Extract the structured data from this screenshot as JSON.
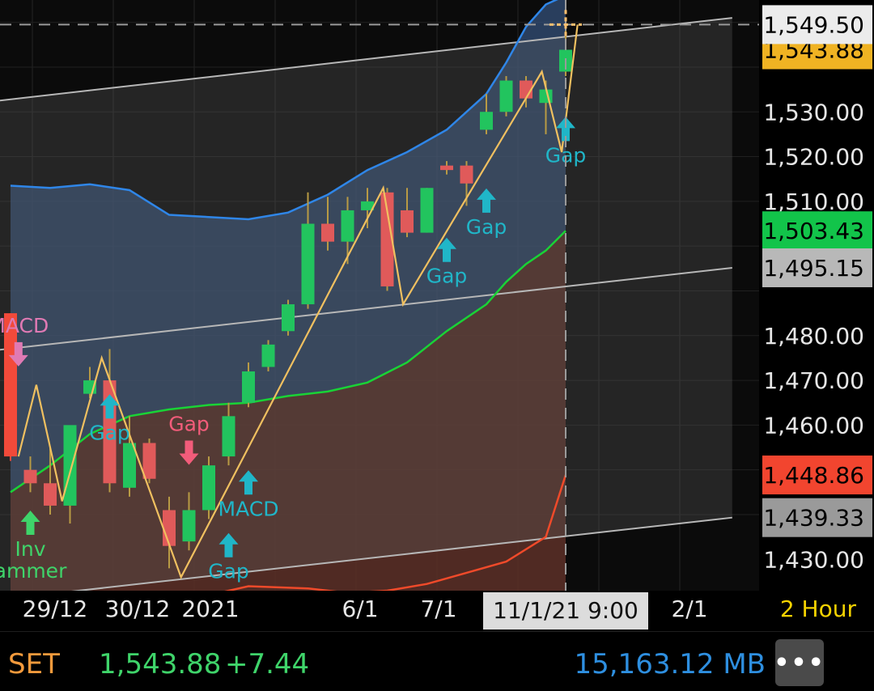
{
  "chart_data": {
    "type": "candlestick",
    "timeframe": "2 Hour",
    "x_tick_labels": [
      "29/12",
      "30/12",
      "2021",
      "6/1",
      "7/1",
      "2/1"
    ],
    "crosshair": {
      "x_label": "11/1/21 9:00",
      "y_label": "1,549.50",
      "y_value": 1549.5
    },
    "y_range": [
      1423,
      1555
    ],
    "y_tick_labels": [
      "1,530.00",
      "1,520.00",
      "1,510.00",
      "1,480.00",
      "1,470.00",
      "1,460.00",
      "1,430.00"
    ],
    "price_badges": [
      {
        "label": "1,543.88",
        "value": 1543.88,
        "bg": "#f0b323",
        "fg": "#000000"
      },
      {
        "label": "1,503.43",
        "value": 1503.43,
        "bg": "#12c44a",
        "fg": "#000000"
      },
      {
        "label": "1,495.15",
        "value": 1495.15,
        "bg": "#b8b8b8",
        "fg": "#000000"
      },
      {
        "label": "1,448.86",
        "value": 1448.86,
        "bg": "#f2452f",
        "fg": "#000000"
      },
      {
        "label": "1,439.33",
        "value": 1439.33,
        "bg": "#9a9a9a",
        "fg": "#000000"
      }
    ],
    "candles": [
      {
        "i": 0,
        "o": 1485.0,
        "h": 1485.0,
        "l": 1452.0,
        "c": 1453.0
      },
      {
        "i": 1,
        "o": 1450.0,
        "h": 1453.0,
        "l": 1445.0,
        "c": 1447.0
      },
      {
        "i": 2,
        "o": 1447.0,
        "h": 1455.0,
        "l": 1440.0,
        "c": 1442.0
      },
      {
        "i": 3,
        "o": 1442.0,
        "h": 1448.0,
        "l": 1438.0,
        "c": 1460.0
      },
      {
        "i": 4,
        "o": 1467.0,
        "h": 1473.0,
        "l": 1466.0,
        "c": 1470.0
      },
      {
        "i": 5,
        "o": 1470.0,
        "h": 1477.0,
        "l": 1445.0,
        "c": 1447.0
      },
      {
        "i": 6,
        "o": 1446.0,
        "h": 1462.0,
        "l": 1444.0,
        "c": 1456.0
      },
      {
        "i": 7,
        "o": 1456.0,
        "h": 1457.0,
        "l": 1447.0,
        "c": 1448.0
      },
      {
        "i": 8,
        "o": 1441.0,
        "h": 1444.0,
        "l": 1428.0,
        "c": 1433.0
      },
      {
        "i": 9,
        "o": 1434.0,
        "h": 1445.0,
        "l": 1432.0,
        "c": 1441.0
      },
      {
        "i": 10,
        "o": 1441.0,
        "h": 1453.0,
        "l": 1439.0,
        "c": 1451.0
      },
      {
        "i": 11,
        "o": 1453.0,
        "h": 1465.0,
        "l": 1451.0,
        "c": 1462.0
      },
      {
        "i": 12,
        "o": 1465.0,
        "h": 1474.0,
        "l": 1464.0,
        "c": 1472.0
      },
      {
        "i": 13,
        "o": 1473.0,
        "h": 1479.0,
        "l": 1472.0,
        "c": 1478.0
      },
      {
        "i": 14,
        "o": 1481.0,
        "h": 1488.0,
        "l": 1480.0,
        "c": 1487.0
      },
      {
        "i": 15,
        "o": 1487.0,
        "h": 1512.0,
        "l": 1486.0,
        "c": 1505.0
      },
      {
        "i": 16,
        "o": 1505.0,
        "h": 1511.0,
        "l": 1499.0,
        "c": 1501.0
      },
      {
        "i": 17,
        "o": 1501.0,
        "h": 1511.0,
        "l": 1496.0,
        "c": 1508.0
      },
      {
        "i": 18,
        "o": 1508.0,
        "h": 1513.0,
        "l": 1504.0,
        "c": 1510.0
      },
      {
        "i": 19,
        "o": 1512.0,
        "h": 1513.0,
        "l": 1490.0,
        "c": 1491.0
      },
      {
        "i": 20,
        "o": 1508.0,
        "h": 1513.0,
        "l": 1502.0,
        "c": 1503.0
      },
      {
        "i": 21,
        "o": 1503.0,
        "h": 1513.0,
        "l": 1503.0,
        "c": 1513.0
      },
      {
        "i": 22,
        "o": 1518.0,
        "h": 1519.0,
        "l": 1516.0,
        "c": 1517.0
      },
      {
        "i": 23,
        "o": 1518.0,
        "h": 1519.0,
        "l": 1509.0,
        "c": 1514.0
      },
      {
        "i": 24,
        "o": 1526.0,
        "h": 1534.0,
        "l": 1525.0,
        "c": 1530.0
      },
      {
        "i": 25,
        "o": 1530.0,
        "h": 1538.0,
        "l": 1529.0,
        "c": 1537.0
      },
      {
        "i": 26,
        "o": 1537.0,
        "h": 1538.0,
        "l": 1531.0,
        "c": 1533.0
      },
      {
        "i": 27,
        "o": 1532.0,
        "h": 1537.0,
        "l": 1525.0,
        "c": 1535.0
      },
      {
        "i": 28,
        "o": 1539.0,
        "h": 1549.5,
        "l": 1538.0,
        "c": 1543.88
      }
    ],
    "bollinger": {
      "upper": [
        [
          0,
          1513.5
        ],
        [
          2,
          1513.0
        ],
        [
          4,
          1513.8
        ],
        [
          6,
          1512.5
        ],
        [
          8,
          1507.0
        ],
        [
          10,
          1506.5
        ],
        [
          12,
          1506.0
        ],
        [
          14,
          1507.5
        ],
        [
          16,
          1511.5
        ],
        [
          18,
          1517.0
        ],
        [
          20,
          1521.0
        ],
        [
          22,
          1526.0
        ],
        [
          24,
          1534.0
        ],
        [
          25,
          1541.0
        ],
        [
          26,
          1549.0
        ],
        [
          27,
          1554.0
        ],
        [
          28,
          1556.0
        ]
      ],
      "middle": [
        [
          0,
          1445.0
        ],
        [
          2,
          1451.0
        ],
        [
          4,
          1458.0
        ],
        [
          6,
          1462.0
        ],
        [
          8,
          1463.5
        ],
        [
          10,
          1464.5
        ],
        [
          12,
          1465.0
        ],
        [
          14,
          1466.5
        ],
        [
          16,
          1467.5
        ],
        [
          18,
          1469.5
        ],
        [
          20,
          1474.0
        ],
        [
          22,
          1481.0
        ],
        [
          24,
          1487.0
        ],
        [
          25,
          1492.0
        ],
        [
          26,
          1496.0
        ],
        [
          27,
          1499.0
        ],
        [
          28,
          1503.43
        ]
      ],
      "lower": [
        [
          9,
          1421.0
        ],
        [
          12,
          1424.0
        ],
        [
          15,
          1423.5
        ],
        [
          17,
          1422.5
        ],
        [
          19,
          1423.0
        ],
        [
          21,
          1424.5
        ],
        [
          23,
          1427.0
        ],
        [
          25,
          1429.5
        ],
        [
          27,
          1435.0
        ],
        [
          28,
          1448.86
        ]
      ]
    },
    "channel": {
      "upper": [
        [
          -0.6,
          1532.5
        ],
        [
          36.4,
          1551.0
        ]
      ],
      "middle": [
        [
          -0.6,
          1476.8
        ],
        [
          36.4,
          1495.15
        ]
      ],
      "lower": [
        [
          -0.6,
          1421.0
        ],
        [
          36.4,
          1439.33
        ]
      ]
    },
    "zigzag": [
      [
        0.4,
        1453.0
      ],
      [
        1.3,
        1469.0
      ],
      [
        2.6,
        1443.0
      ],
      [
        4.6,
        1475.0
      ],
      [
        8.6,
        1426.0
      ],
      [
        18.8,
        1513.0
      ],
      [
        19.8,
        1487.0
      ],
      [
        26.8,
        1539.0
      ],
      [
        27.8,
        1521.0
      ],
      [
        28.6,
        1549.5
      ]
    ],
    "signals": [
      {
        "i": 0.4,
        "label": "MACD",
        "dir": "down",
        "value": 1476.0,
        "color": "#e07ab4"
      },
      {
        "i": 1.0,
        "label": "Inv\nammer",
        "dir": "up",
        "value": 1438.0,
        "color": "#3fd46a"
      },
      {
        "i": 5.0,
        "label": "Gap",
        "dir": "up",
        "value": 1464.0,
        "color": "#20b6c8"
      },
      {
        "i": 9.0,
        "label": "Gap",
        "dir": "down",
        "value": 1454.0,
        "color": "#f25c7a"
      },
      {
        "i": 11.0,
        "label": "Gap",
        "dir": "up",
        "value": 1433.0,
        "color": "#20b6c8"
      },
      {
        "i": 12.0,
        "label": "MACD",
        "dir": "up",
        "value": 1447.0,
        "color": "#20b6c8"
      },
      {
        "i": 22.0,
        "label": "Gap",
        "dir": "up",
        "value": 1499.0,
        "color": "#20b6c8"
      },
      {
        "i": 24.0,
        "label": "Gap",
        "dir": "up",
        "value": 1510.0,
        "color": "#20b6c8"
      },
      {
        "i": 28.0,
        "label": "Gap",
        "dir": "up",
        "value": 1526.0,
        "color": "#20b6c8"
      }
    ],
    "colors": {
      "up": "#22c45e",
      "down": "#e05a5a",
      "bb_upper": "#2f86e8",
      "bb_middle": "#19d336",
      "bb_lower": "#ef4a2a",
      "channel": "#b7b7b7",
      "zigzag": "#f0c060"
    },
    "grid": true
  },
  "bottom_bar": {
    "symbol": "SET",
    "last": "1,543.88",
    "change": "+7.44",
    "volume": "15,163.12 MB",
    "more_label": "•••"
  }
}
